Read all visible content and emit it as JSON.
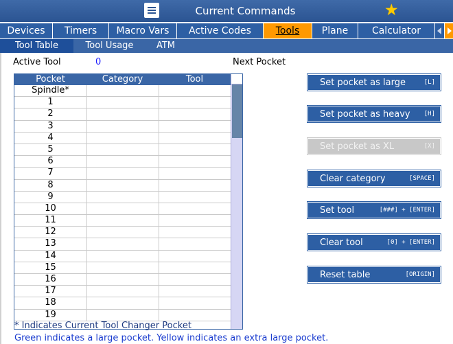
{
  "header": {
    "title": "Current Commands"
  },
  "tabs": [
    {
      "label": "Devices",
      "active": false
    },
    {
      "label": "Timers",
      "active": false
    },
    {
      "label": "Macro Vars",
      "active": false
    },
    {
      "label": "Active Codes",
      "active": false
    },
    {
      "label": "Tools",
      "active": true
    },
    {
      "label": "Plane",
      "active": false
    },
    {
      "label": "Calculator",
      "active": false
    }
  ],
  "subtabs": [
    {
      "label": "Tool Table",
      "active": true
    },
    {
      "label": "Tool Usage",
      "active": false
    },
    {
      "label": "ATM",
      "active": false
    }
  ],
  "status": {
    "active_tool_label": "Active Tool",
    "active_tool_value": "0",
    "next_pocket_label": "Next Pocket"
  },
  "table": {
    "columns": [
      "Pocket",
      "Category",
      "Tool"
    ],
    "rows": [
      [
        "Spindle*",
        "",
        ""
      ],
      [
        "1",
        "",
        ""
      ],
      [
        "2",
        "",
        ""
      ],
      [
        "3",
        "",
        ""
      ],
      [
        "4",
        "",
        ""
      ],
      [
        "5",
        "",
        ""
      ],
      [
        "6",
        "",
        ""
      ],
      [
        "7",
        "",
        ""
      ],
      [
        "8",
        "",
        ""
      ],
      [
        "9",
        "",
        ""
      ],
      [
        "10",
        "",
        ""
      ],
      [
        "11",
        "",
        ""
      ],
      [
        "12",
        "",
        ""
      ],
      [
        "13",
        "",
        ""
      ],
      [
        "14",
        "",
        ""
      ],
      [
        "15",
        "",
        ""
      ],
      [
        "16",
        "",
        ""
      ],
      [
        "17",
        "",
        ""
      ],
      [
        "18",
        "",
        ""
      ],
      [
        "19",
        "",
        ""
      ]
    ]
  },
  "buttons": [
    {
      "label": "Set pocket as large",
      "key": "[L]",
      "enabled": true
    },
    {
      "label": "Set pocket as heavy",
      "key": "[H]",
      "enabled": true
    },
    {
      "label": "Set pocket as XL",
      "key": "[X]",
      "enabled": false
    },
    {
      "label": "Clear category",
      "key": "[SPACE]",
      "enabled": true
    },
    {
      "label": "Set tool",
      "key": "[###] + [ENTER]",
      "enabled": true
    },
    {
      "label": "Clear tool",
      "key": "[0] + [ENTER]",
      "enabled": true
    },
    {
      "label": "Reset table",
      "key": "[ORIGIN]",
      "enabled": true
    }
  ],
  "notes": {
    "current_pocket": "* Indicates Current Tool Changer Pocket",
    "pocket_colors": "Green indicates a large pocket. Yellow indicates an extra large pocket."
  },
  "colors": {
    "accent": "#2d5fa4",
    "active_tab": "#ff9900",
    "star": "#ffcc00"
  }
}
